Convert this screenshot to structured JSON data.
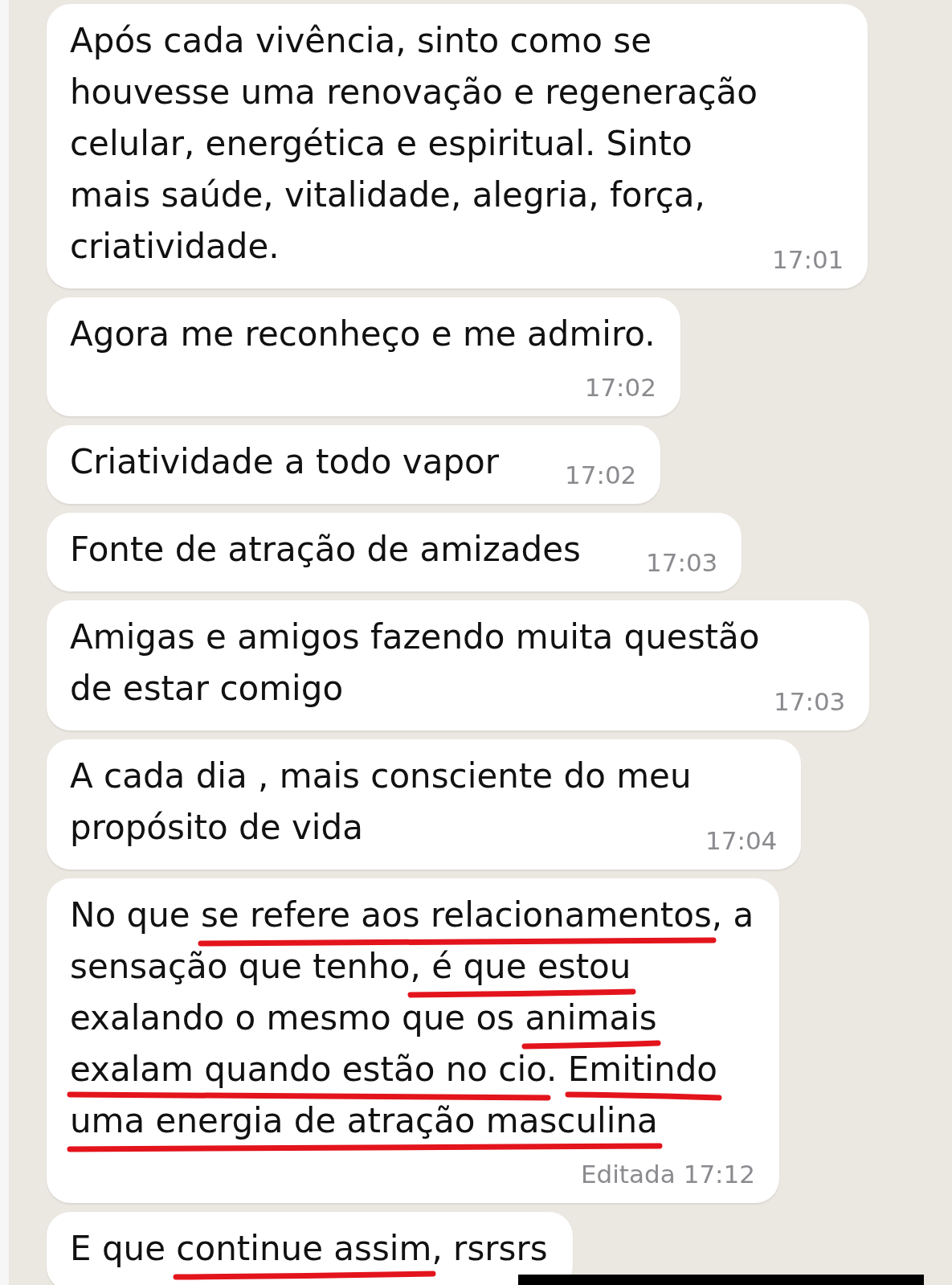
{
  "chat": {
    "messages": [
      {
        "parts": [
          {
            "text": "Após cada vivência, sinto como se houvesse uma renovação e regeneração celular, energética e espiritual. Sinto mais saúde, vitalidade, alegria, força, criatividade.",
            "underlined": false
          }
        ],
        "time": "17:01"
      },
      {
        "parts": [
          {
            "text": "Agora me reconheço e me admiro.",
            "underlined": false
          }
        ],
        "time": "17:02"
      },
      {
        "parts": [
          {
            "text": "Criatividade a todo vapor",
            "underlined": false
          }
        ],
        "time": "17:02"
      },
      {
        "parts": [
          {
            "text": "Fonte de atração de amizades",
            "underlined": false
          }
        ],
        "time": "17:03"
      },
      {
        "parts": [
          {
            "text": "Amigas e amigos fazendo muita questão de estar comigo",
            "underlined": false
          }
        ],
        "time": "17:03"
      },
      {
        "parts": [
          {
            "text": "A cada dia , mais consciente do meu propósito de vida",
            "underlined": false
          }
        ],
        "time": "17:04"
      },
      {
        "parts": [
          {
            "text": "No que ",
            "underlined": false
          },
          {
            "text": "se refere aos relacionamentos",
            "underlined": true
          },
          {
            "text": ", a sensação que tenho",
            "underlined": false
          },
          {
            "text": ", é que estou",
            "underlined": true
          },
          {
            "text": " exalando o mesmo que os ",
            "underlined": false
          },
          {
            "text": "animais ",
            "underlined": true
          },
          {
            "text": "exalam quando estão no cio",
            "underlined": true
          },
          {
            "text": ". ",
            "underlined": false
          },
          {
            "text": "Emitindo uma energia de atração masculina",
            "underlined": true
          }
        ],
        "edited_label": "Editada",
        "time": "17:12"
      },
      {
        "parts": [
          {
            "text": "E que ",
            "underlined": false
          },
          {
            "text": "continue assim",
            "underlined": true
          },
          {
            "text": ", rsrsrs",
            "underlined": false
          }
        ]
      }
    ]
  }
}
